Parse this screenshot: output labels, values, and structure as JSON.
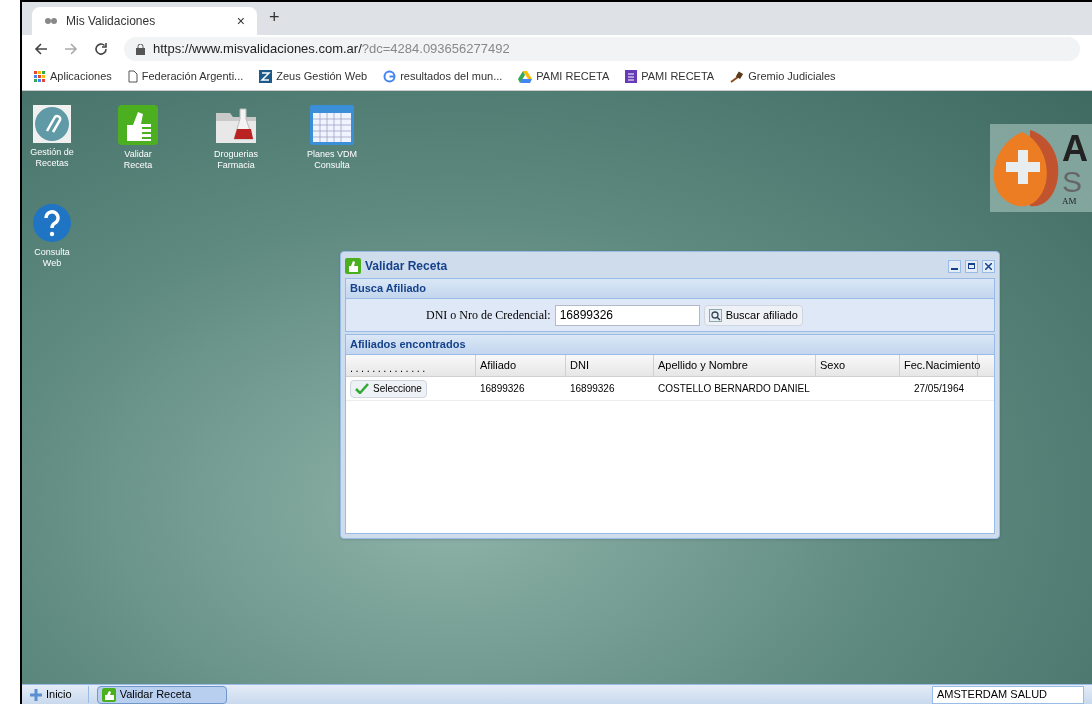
{
  "browser": {
    "tab": {
      "title": "Mis Validaciones",
      "close": "×"
    },
    "new_tab": "+",
    "url_main": "https://www.misvalidaciones.com.ar/",
    "url_rest": "?dc=4284.093656277492",
    "bookmarks": [
      {
        "kind": "apps",
        "label": "Aplicaciones"
      },
      {
        "kind": "page",
        "label": "Federación Argenti..."
      },
      {
        "kind": "zeus",
        "label": "Zeus Gestión Web"
      },
      {
        "kind": "google",
        "label": "resultados del mun..."
      },
      {
        "kind": "drive",
        "label": "PAMI RECETA"
      },
      {
        "kind": "forms",
        "label": "PAMI RECETA"
      },
      {
        "kind": "gavel",
        "label": "Gremio Judiciales"
      }
    ]
  },
  "desktop_icons": [
    {
      "kind": "clip",
      "label": "Gestión de\nRecetas"
    },
    {
      "kind": "thumb",
      "label": "Validar\nReceta"
    },
    {
      "kind": "folder",
      "label": "Droguerias\nFarmacia"
    },
    {
      "kind": "calendar",
      "label": "Planes VDM\nConsulta"
    },
    {
      "kind": "help",
      "label": "Consulta\nWeb"
    }
  ],
  "logo": {
    "letter_1": "A",
    "letter_2": "S",
    "small": "AM"
  },
  "window": {
    "title": "Validar Receta",
    "search_section": {
      "title": "Busca Afiliado",
      "field_label": "DNI o Nro de Credencial:",
      "value": "16899326",
      "button": "Buscar afiliado"
    },
    "results_section": {
      "title": "Afiliados encontrados",
      "columns": [
        ". . . . . . . . . . . . . .",
        "Afiliado",
        "DNI",
        "Apellido y Nombre",
        "Sexo",
        "Fec.Nacimiento"
      ],
      "rows": [
        {
          "button": "Seleccione",
          "afiliado": "16899326",
          "dni": "16899326",
          "nombre": "COSTELLO BERNARDO DANIEL",
          "sexo": "",
          "fecha": "27/05/1964"
        }
      ]
    }
  },
  "taskbar": {
    "start": "Inicio",
    "tasks": [
      {
        "label": "Validar Receta",
        "selected": true
      }
    ],
    "status": "AMSTERDAM SALUD"
  }
}
